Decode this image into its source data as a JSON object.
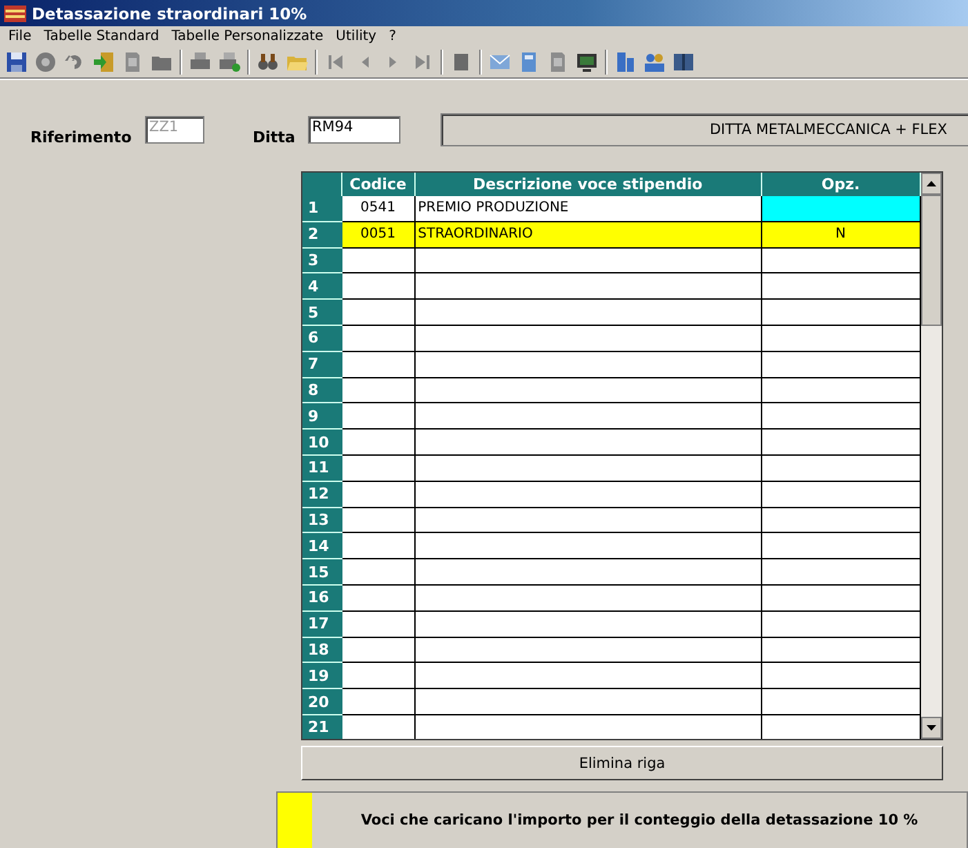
{
  "window": {
    "title": "Detassazione straordinari 10%"
  },
  "menu": [
    "File",
    "Tabelle Standard",
    "Tabelle Personalizzate",
    "Utility",
    "?"
  ],
  "form": {
    "riferimento_label": "Riferimento",
    "riferimento_value": "ZZ1",
    "riferimento_disabled": true,
    "ditta_label": "Ditta",
    "ditta_value": "RM94",
    "ditta_name": "DITTA METALMECCANICA + FLEX"
  },
  "table": {
    "columns": [
      "Codice",
      "Descrizione voce stipendio",
      "Opz."
    ],
    "rows": [
      {
        "number": "1",
        "codice": "0541",
        "descrizione": "PREMIO PRODUZIONE",
        "opz": {
          "color": "#00ffff"
        }
      },
      {
        "number": "2",
        "codice": "0051",
        "descrizione": "STRAORDINARIO",
        "opz": {
          "value": "N"
        },
        "color": "#ffff00"
      },
      {
        "number": "3"
      },
      {
        "number": "4"
      },
      {
        "number": "5"
      },
      {
        "number": "6"
      },
      {
        "number": "7"
      },
      {
        "number": "8"
      },
      {
        "number": "9"
      },
      {
        "number": "10"
      },
      {
        "number": "11"
      },
      {
        "number": "12"
      },
      {
        "number": "13"
      },
      {
        "number": "14"
      },
      {
        "number": "15"
      },
      {
        "number": "16"
      },
      {
        "number": "17"
      },
      {
        "number": "18"
      },
      {
        "number": "19"
      },
      {
        "number": "20"
      },
      {
        "number": "21"
      }
    ]
  },
  "delete_button": "Elimina riga",
  "legend": {
    "color": "#ffff00",
    "text": "Voci che caricano l'importo per il conteggio della detassazione 10 %"
  }
}
